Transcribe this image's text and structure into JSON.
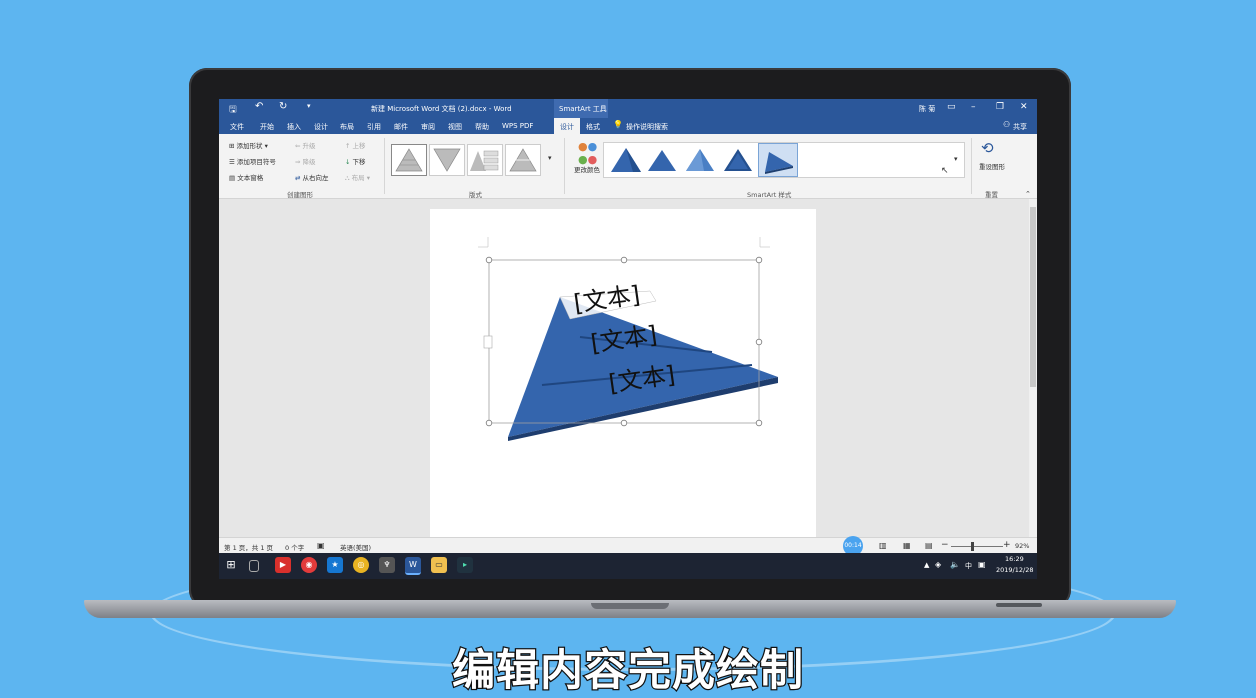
{
  "window": {
    "title": "新建 Microsoft Word 文档 (2).docx - Word",
    "context_tab": "SmartArt 工具",
    "user": "陈 菊"
  },
  "tabs": [
    "文件",
    "开始",
    "插入",
    "设计",
    "布局",
    "引用",
    "邮件",
    "审阅",
    "视图",
    "帮助",
    "WPS PDF",
    "设计",
    "格式"
  ],
  "tell_me": "操作说明搜索",
  "share": "共享",
  "ribbon": {
    "create_graphic": {
      "add_shape": "添加形状",
      "add_bullet": "添加项目符号",
      "text_pane": "文本窗格",
      "promote": "升级",
      "demote": "降级",
      "right_to_left": "从右向左",
      "move_up": "上移",
      "move_down": "下移",
      "layout": "布局",
      "group_label": "创建图形"
    },
    "layouts_label": "版式",
    "change_colors": "更改颜色",
    "styles_label": "SmartArt 样式",
    "reset_graphic": "重设图形",
    "reset_label": "重置"
  },
  "diagram": {
    "items": [
      "[文本]",
      "[文本]",
      "[文本]"
    ],
    "fill": "#3465ad"
  },
  "status": {
    "page": "第 1 页，共 1 页",
    "words": "0 个字",
    "language": "英语(美国)",
    "zoom": "92%",
    "timer": "00:14"
  },
  "taskbar": {
    "time": "16:29",
    "date": "2019/12/28",
    "ime": "中"
  },
  "subtitle": "编辑内容完成绘制",
  "colors": {
    "accent": "#2b579a",
    "background": "#5db5f0"
  }
}
